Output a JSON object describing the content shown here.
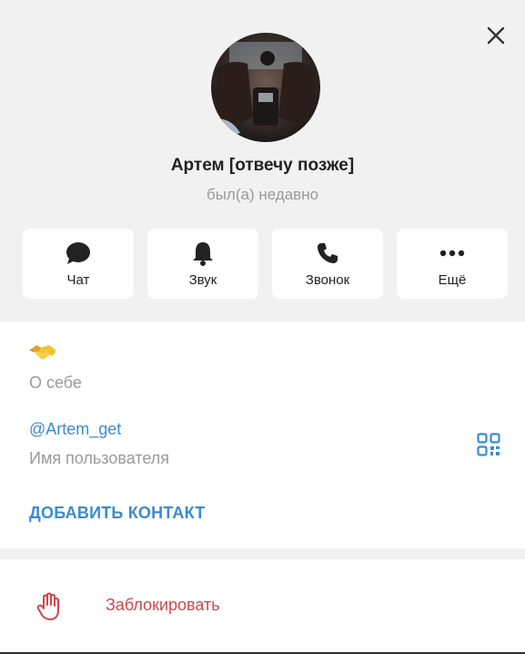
{
  "profile": {
    "name": "Артем [отвечу позже]",
    "status": "был(а) недавно"
  },
  "actions": [
    {
      "label": "Чат",
      "icon": "chat-bubble-icon"
    },
    {
      "label": "Звук",
      "icon": "bell-icon"
    },
    {
      "label": "Звонок",
      "icon": "phone-icon"
    },
    {
      "label": "Ещё",
      "icon": "more-dots-icon"
    }
  ],
  "info": {
    "about_emoji": "handshake-emoji",
    "about_label": "О себе",
    "username": "@Artem_get",
    "username_label": "Имя пользователя",
    "add_contact": "ДОБАВИТЬ КОНТАКТ"
  },
  "block": {
    "label": "Заблокировать",
    "icon": "hand-stop-icon"
  },
  "colors": {
    "accent": "#3a8bd1",
    "danger": "#d1464a",
    "background": "#f1f1f1",
    "card": "#ffffff"
  }
}
